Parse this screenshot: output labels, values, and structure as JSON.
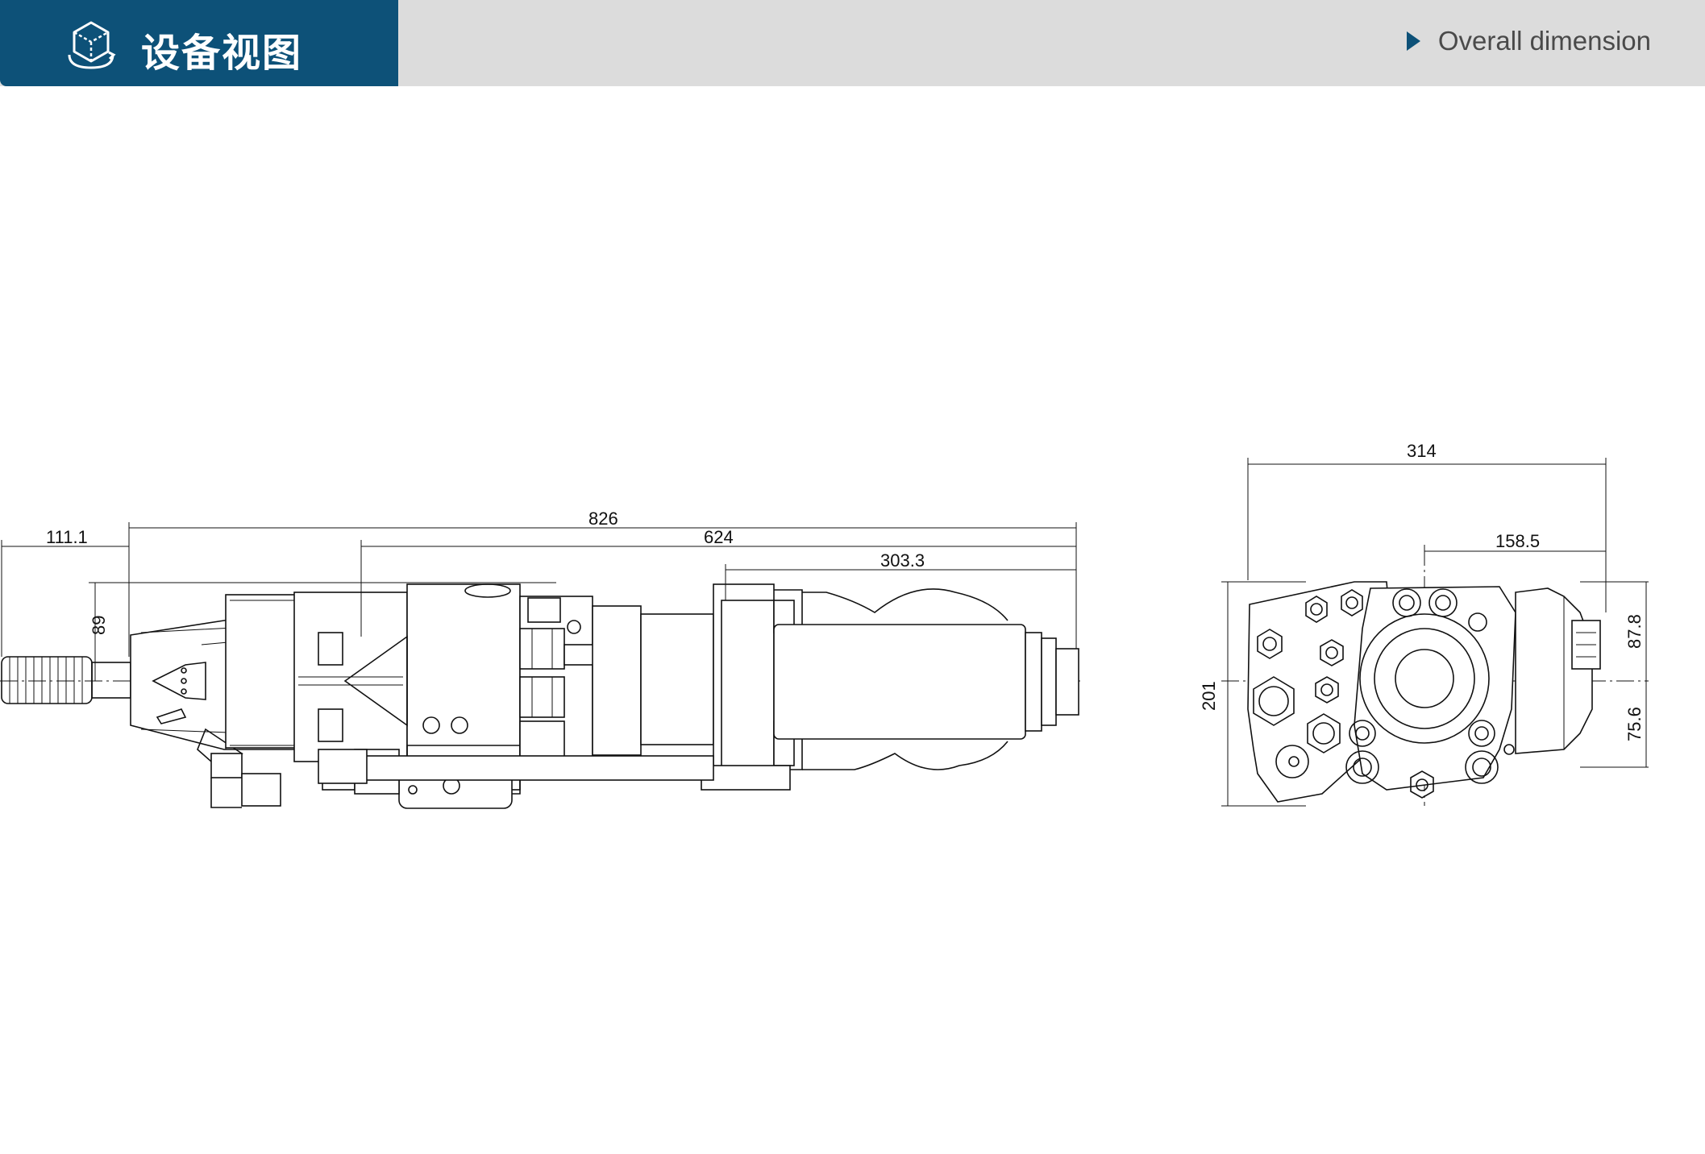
{
  "header": {
    "title": "设备视图",
    "section_label": "Overall dimension",
    "icon": "3d-cube-icon",
    "arrow_icon": "play-triangle-icon",
    "colors": {
      "title_bg": "#0d5178",
      "bar_bg": "#dcdcdc",
      "text": "#4a4a4a"
    }
  },
  "side_view": {
    "dimensions": {
      "d_111_1": "111.1",
      "d_826": "826",
      "d_624": "624",
      "d_303_3": "303.3",
      "d_89": "89"
    }
  },
  "end_view": {
    "dimensions": {
      "d_314": "314",
      "d_158_5": "158.5",
      "d_201": "201",
      "d_87_8": "87.8",
      "d_75_6": "75.6"
    }
  }
}
